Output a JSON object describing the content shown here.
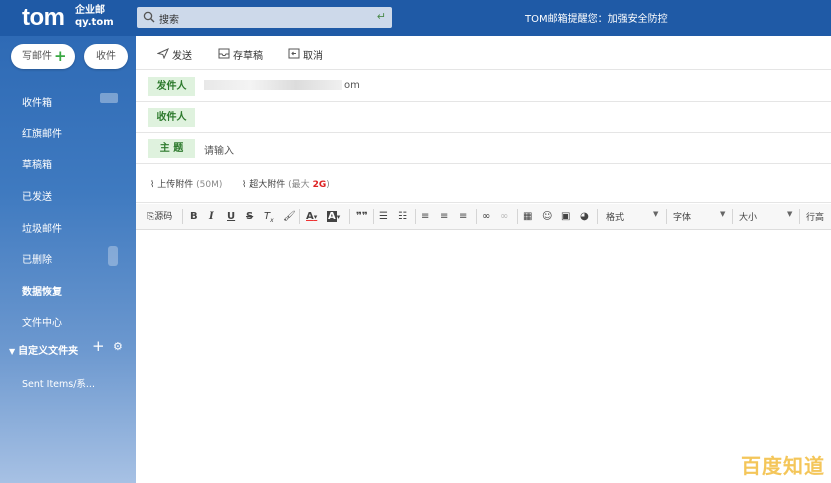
{
  "header": {
    "logo": "tom",
    "logo_sub_1": "企业邮",
    "logo_sub_2": "qy.tom",
    "search_placeholder": "搜索",
    "notice": "TOM邮箱提醒您：加强安全防控"
  },
  "sidebar": {
    "compose_label": "写邮件",
    "receive_label": "收件",
    "items": [
      "收件箱",
      "红旗邮件",
      "草稿箱",
      "已发送",
      "垃圾邮件",
      "已删除",
      "数据恢复",
      "文件中心"
    ],
    "custom_folders_label": "自定义文件夹",
    "sent_items_label": "Sent Items/系..."
  },
  "toolbar": {
    "send_label": "发送",
    "draft_label": "存草稿",
    "cancel_label": "取消"
  },
  "form": {
    "from_label": "发件人",
    "from_value_suffix": "om",
    "to_label": "收件人",
    "subject_label": "主 题",
    "subject_placeholder": "请输入"
  },
  "attachments": {
    "upload_label": "上传附件",
    "upload_limit": "(50M)",
    "big_label": "超大附件",
    "big_limit_prefix": "(最大",
    "big_limit_value": "2G",
    "big_limit_suffix": ")"
  },
  "editor_toolbar": {
    "source_label": "源码",
    "format_label": "格式",
    "font_label": "字体",
    "size_label": "大小",
    "line_height_label": "行高"
  },
  "watermark": "百度知道",
  "colors": {
    "header_bg": "#1f5aa6",
    "label_bg": "#dff2de",
    "label_text": "#2d7a2d",
    "accent_red": "#dd2222",
    "plus_green": "#3aa843"
  }
}
